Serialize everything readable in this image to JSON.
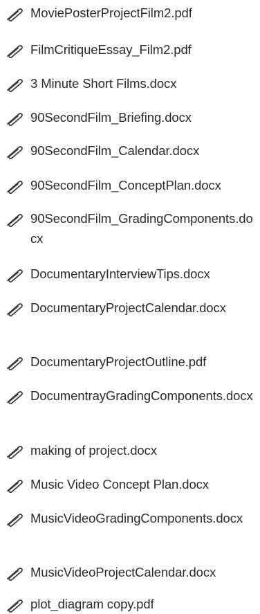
{
  "attachments": [
    {
      "name": "MoviePosterProjectFilm2.pdf",
      "icon": "paperclip-icon"
    },
    {
      "name": "FilmCritiqueEssay_Film2.pdf",
      "icon": "paperclip-icon"
    },
    {
      "name": "3 Minute Short Films.docx",
      "icon": "paperclip-icon"
    },
    {
      "name": "90SecondFilm_Briefing.docx",
      "icon": "paperclip-icon"
    },
    {
      "name": "90SecondFilm_Calendar.docx",
      "icon": "paperclip-icon"
    },
    {
      "name": "90SecondFilm_ConceptPlan.docx",
      "icon": "paperclip-icon"
    },
    {
      "name": "90SecondFilm_GradingComponents.docx",
      "icon": "paperclip-icon"
    },
    {
      "name": "DocumentaryInterviewTips.docx",
      "icon": "paperclip-icon"
    },
    {
      "name": "DocumentaryProjectCalendar.docx",
      "icon": "paperclip-icon"
    },
    {
      "name": "DocumentaryProjectOutline.pdf",
      "icon": "paperclip-icon"
    },
    {
      "name": "DocumentrayGradingComponents.docx",
      "icon": "paperclip-icon"
    },
    {
      "name": "making of project.docx",
      "icon": "paperclip-icon"
    },
    {
      "name": "Music Video Concept Plan.docx",
      "icon": "paperclip-icon"
    },
    {
      "name": "MusicVideoGradingComponents.docx",
      "icon": "paperclip-icon"
    },
    {
      "name": "MusicVideoProjectCalendar.docx",
      "icon": "paperclip-icon"
    },
    {
      "name": "plot_diagram copy.pdf",
      "icon": "paperclip-icon"
    }
  ],
  "colors": {
    "text": "#2b2b2b",
    "icon": "#3a3a3a",
    "background": "#ffffff"
  }
}
